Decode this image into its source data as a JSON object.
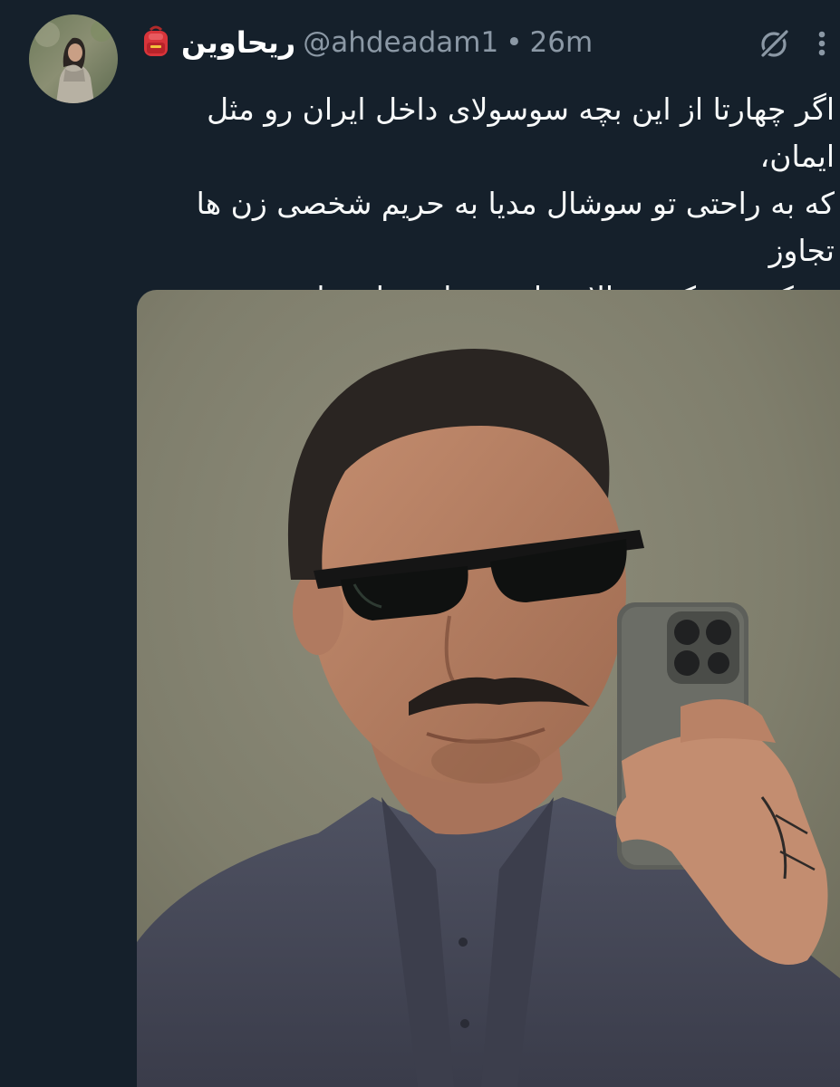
{
  "tweet": {
    "author": {
      "display_name": "ریحاوین",
      "name_emoji": "backpack-emoji",
      "handle": "@ahdeadam1",
      "avatar_icon": "profile-avatar"
    },
    "separator": "•",
    "time": "26m",
    "text": "اگر چهارتا از این بچه سوسولای داخل ایران رو مثل ایمان،\nکه به راحتی تو سوشال مدیا به حریم شخصی زن ها تجاوز\nمی‌کنه رو بکشن بالای دار بقیه این عادت از سرشون میوفته\nو سرشون رو به زندگی خودشون گرم میکنن😌",
    "icons": {
      "grok": "grok-icon",
      "more": "more-options-icon"
    },
    "media": {
      "type": "photo",
      "description_icon": "mirror-selfie-photo"
    },
    "colors": {
      "background": "#15202b",
      "text": "#f7f9f9",
      "secondary": "#8b98a5"
    }
  }
}
